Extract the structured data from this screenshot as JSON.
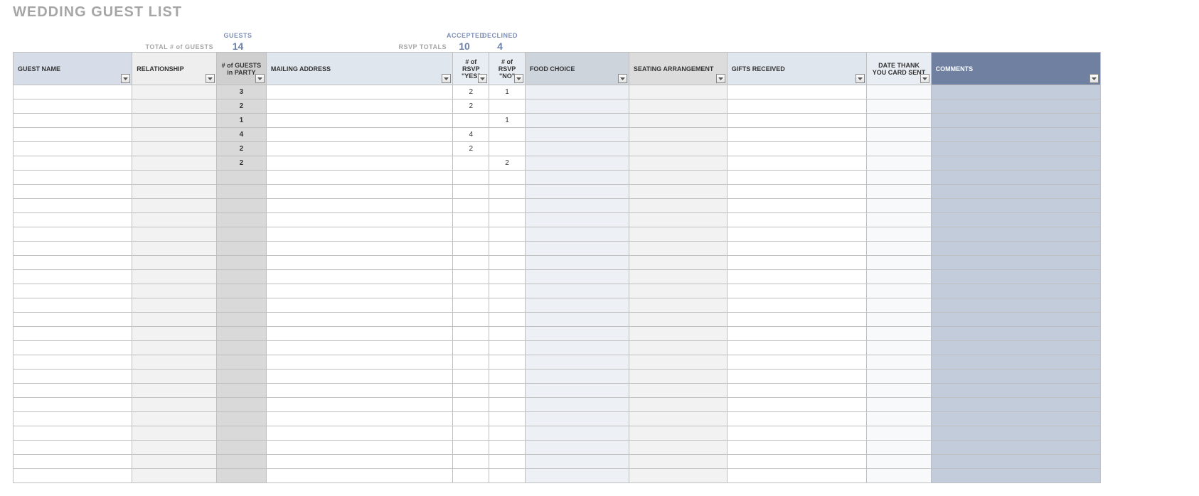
{
  "title": "WEDDING GUEST LIST",
  "summary": {
    "total_label": "TOTAL # of GUESTS",
    "guests_label": "GUESTS",
    "guests_value": "14",
    "rsvp_label": "RSVP TOTALS",
    "accepted_label": "ACCEPTED",
    "accepted_value": "10",
    "declined_label": "DECLINED",
    "declined_value": "4"
  },
  "headers": {
    "guest_name": "GUEST NAME",
    "relationship": "RELATIONSHIP",
    "guests_in_party": "# of GUESTS in PARTY",
    "mailing_address": "MAILING ADDRESS",
    "rsvp_yes": "# of RSVP \"YES\"",
    "rsvp_no": "# of RSVP \"NO\"",
    "food_choice": "FOOD CHOICE",
    "seating": "SEATING ARRANGEMENT",
    "gifts": "GIFTS RECEIVED",
    "thank_you": "DATE THANK YOU CARD SENT",
    "comments": "COMMENTS"
  },
  "rows": [
    {
      "guest_name": "",
      "relationship": "",
      "party": "3",
      "mail": "",
      "yes": "2",
      "no": "1",
      "food": "",
      "seat": "",
      "gift": "",
      "thank": "",
      "comm": ""
    },
    {
      "guest_name": "",
      "relationship": "",
      "party": "2",
      "mail": "",
      "yes": "2",
      "no": "",
      "food": "",
      "seat": "",
      "gift": "",
      "thank": "",
      "comm": ""
    },
    {
      "guest_name": "",
      "relationship": "",
      "party": "1",
      "mail": "",
      "yes": "",
      "no": "1",
      "food": "",
      "seat": "",
      "gift": "",
      "thank": "",
      "comm": ""
    },
    {
      "guest_name": "",
      "relationship": "",
      "party": "4",
      "mail": "",
      "yes": "4",
      "no": "",
      "food": "",
      "seat": "",
      "gift": "",
      "thank": "",
      "comm": ""
    },
    {
      "guest_name": "",
      "relationship": "",
      "party": "2",
      "mail": "",
      "yes": "2",
      "no": "",
      "food": "",
      "seat": "",
      "gift": "",
      "thank": "",
      "comm": ""
    },
    {
      "guest_name": "",
      "relationship": "",
      "party": "2",
      "mail": "",
      "yes": "",
      "no": "2",
      "food": "",
      "seat": "",
      "gift": "",
      "thank": "",
      "comm": ""
    },
    {
      "guest_name": "",
      "relationship": "",
      "party": "",
      "mail": "",
      "yes": "",
      "no": "",
      "food": "",
      "seat": "",
      "gift": "",
      "thank": "",
      "comm": ""
    },
    {
      "guest_name": "",
      "relationship": "",
      "party": "",
      "mail": "",
      "yes": "",
      "no": "",
      "food": "",
      "seat": "",
      "gift": "",
      "thank": "",
      "comm": ""
    },
    {
      "guest_name": "",
      "relationship": "",
      "party": "",
      "mail": "",
      "yes": "",
      "no": "",
      "food": "",
      "seat": "",
      "gift": "",
      "thank": "",
      "comm": ""
    },
    {
      "guest_name": "",
      "relationship": "",
      "party": "",
      "mail": "",
      "yes": "",
      "no": "",
      "food": "",
      "seat": "",
      "gift": "",
      "thank": "",
      "comm": ""
    },
    {
      "guest_name": "",
      "relationship": "",
      "party": "",
      "mail": "",
      "yes": "",
      "no": "",
      "food": "",
      "seat": "",
      "gift": "",
      "thank": "",
      "comm": ""
    },
    {
      "guest_name": "",
      "relationship": "",
      "party": "",
      "mail": "",
      "yes": "",
      "no": "",
      "food": "",
      "seat": "",
      "gift": "",
      "thank": "",
      "comm": ""
    },
    {
      "guest_name": "",
      "relationship": "",
      "party": "",
      "mail": "",
      "yes": "",
      "no": "",
      "food": "",
      "seat": "",
      "gift": "",
      "thank": "",
      "comm": ""
    },
    {
      "guest_name": "",
      "relationship": "",
      "party": "",
      "mail": "",
      "yes": "",
      "no": "",
      "food": "",
      "seat": "",
      "gift": "",
      "thank": "",
      "comm": ""
    },
    {
      "guest_name": "",
      "relationship": "",
      "party": "",
      "mail": "",
      "yes": "",
      "no": "",
      "food": "",
      "seat": "",
      "gift": "",
      "thank": "",
      "comm": ""
    },
    {
      "guest_name": "",
      "relationship": "",
      "party": "",
      "mail": "",
      "yes": "",
      "no": "",
      "food": "",
      "seat": "",
      "gift": "",
      "thank": "",
      "comm": ""
    },
    {
      "guest_name": "",
      "relationship": "",
      "party": "",
      "mail": "",
      "yes": "",
      "no": "",
      "food": "",
      "seat": "",
      "gift": "",
      "thank": "",
      "comm": ""
    },
    {
      "guest_name": "",
      "relationship": "",
      "party": "",
      "mail": "",
      "yes": "",
      "no": "",
      "food": "",
      "seat": "",
      "gift": "",
      "thank": "",
      "comm": ""
    },
    {
      "guest_name": "",
      "relationship": "",
      "party": "",
      "mail": "",
      "yes": "",
      "no": "",
      "food": "",
      "seat": "",
      "gift": "",
      "thank": "",
      "comm": ""
    },
    {
      "guest_name": "",
      "relationship": "",
      "party": "",
      "mail": "",
      "yes": "",
      "no": "",
      "food": "",
      "seat": "",
      "gift": "",
      "thank": "",
      "comm": ""
    },
    {
      "guest_name": "",
      "relationship": "",
      "party": "",
      "mail": "",
      "yes": "",
      "no": "",
      "food": "",
      "seat": "",
      "gift": "",
      "thank": "",
      "comm": ""
    },
    {
      "guest_name": "",
      "relationship": "",
      "party": "",
      "mail": "",
      "yes": "",
      "no": "",
      "food": "",
      "seat": "",
      "gift": "",
      "thank": "",
      "comm": ""
    },
    {
      "guest_name": "",
      "relationship": "",
      "party": "",
      "mail": "",
      "yes": "",
      "no": "",
      "food": "",
      "seat": "",
      "gift": "",
      "thank": "",
      "comm": ""
    },
    {
      "guest_name": "",
      "relationship": "",
      "party": "",
      "mail": "",
      "yes": "",
      "no": "",
      "food": "",
      "seat": "",
      "gift": "",
      "thank": "",
      "comm": ""
    },
    {
      "guest_name": "",
      "relationship": "",
      "party": "",
      "mail": "",
      "yes": "",
      "no": "",
      "food": "",
      "seat": "",
      "gift": "",
      "thank": "",
      "comm": ""
    },
    {
      "guest_name": "",
      "relationship": "",
      "party": "",
      "mail": "",
      "yes": "",
      "no": "",
      "food": "",
      "seat": "",
      "gift": "",
      "thank": "",
      "comm": ""
    },
    {
      "guest_name": "",
      "relationship": "",
      "party": "",
      "mail": "",
      "yes": "",
      "no": "",
      "food": "",
      "seat": "",
      "gift": "",
      "thank": "",
      "comm": ""
    },
    {
      "guest_name": "",
      "relationship": "",
      "party": "",
      "mail": "",
      "yes": "",
      "no": "",
      "food": "",
      "seat": "",
      "gift": "",
      "thank": "",
      "comm": ""
    }
  ]
}
